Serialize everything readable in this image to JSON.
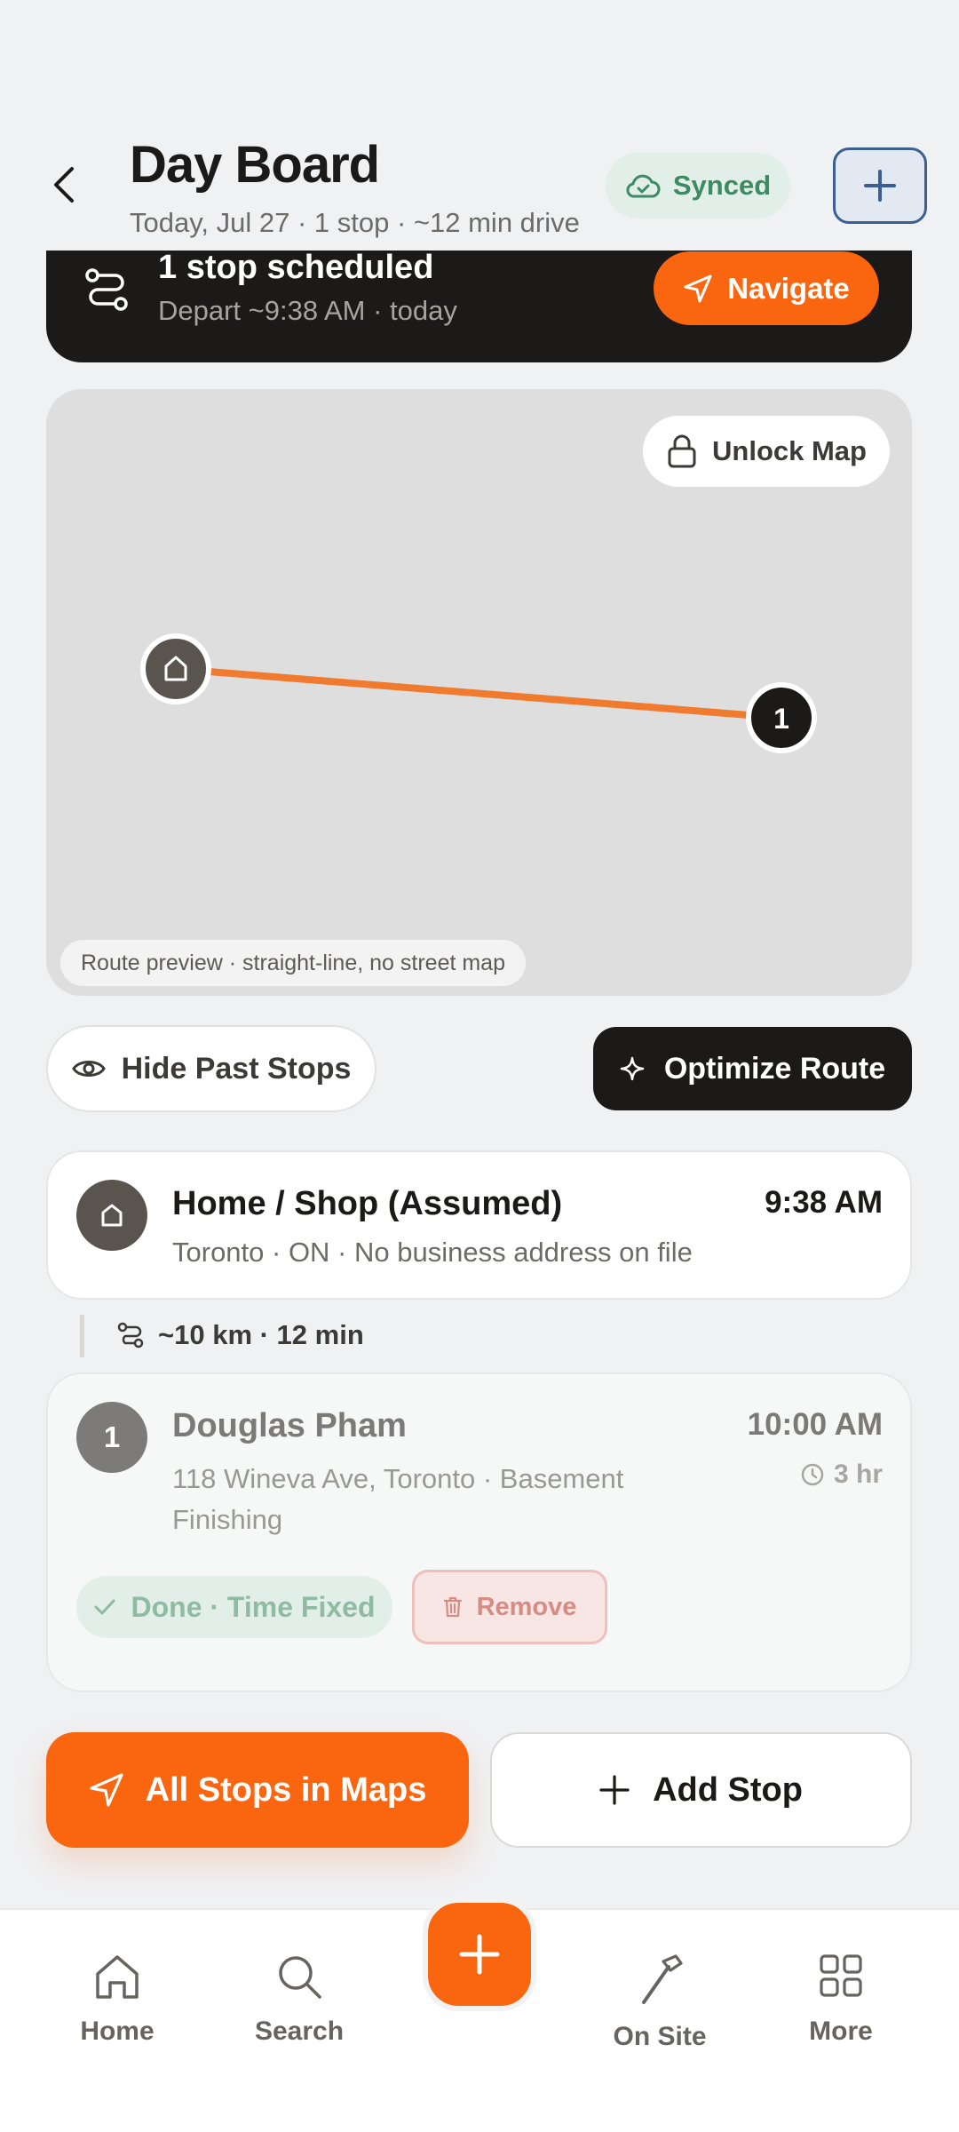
{
  "header": {
    "title": "Day Board",
    "subtitle": "Today, Jul 27 · 1 stop · ~12 min drive",
    "sync_label": "Synced",
    "back_icon": "chevron-left-icon",
    "add_icon": "plus-icon"
  },
  "banner": {
    "title": "1 stop scheduled",
    "subtitle": "Depart ~9:38 AM · today",
    "navigate_label": "Navigate"
  },
  "map": {
    "unlock_label": "Unlock Map",
    "caption": "Route preview · straight-line, no street map",
    "stop_marker_label": "1",
    "route_color": "#f07a2e"
  },
  "actions": {
    "hide_past_label": "Hide Past Stops",
    "optimize_label": "Optimize Route"
  },
  "home": {
    "title": "Home / Shop (Assumed)",
    "address": "Toronto · ON · No business address on file",
    "time": "9:38 AM"
  },
  "leg": {
    "text": "~10 km · 12 min"
  },
  "stop": {
    "number": "1",
    "name": "Douglas Pham",
    "address": "118 Wineva Ave, Toronto · Basement Finishing",
    "time": "10:00 AM",
    "duration": "3 hr",
    "status": "Done · Time Fixed",
    "remove_label": "Remove"
  },
  "bottom_actions": {
    "maps_label": "All Stops in Maps",
    "add_stop_label": "Add Stop"
  },
  "tabbar": {
    "home": "Home",
    "search": "Search",
    "onsite": "On Site",
    "more": "More"
  },
  "colors": {
    "accent": "#fa6610",
    "dark": "#1b1a18",
    "synced_green": "#3d8a63",
    "remove_red": "#d68b83"
  }
}
